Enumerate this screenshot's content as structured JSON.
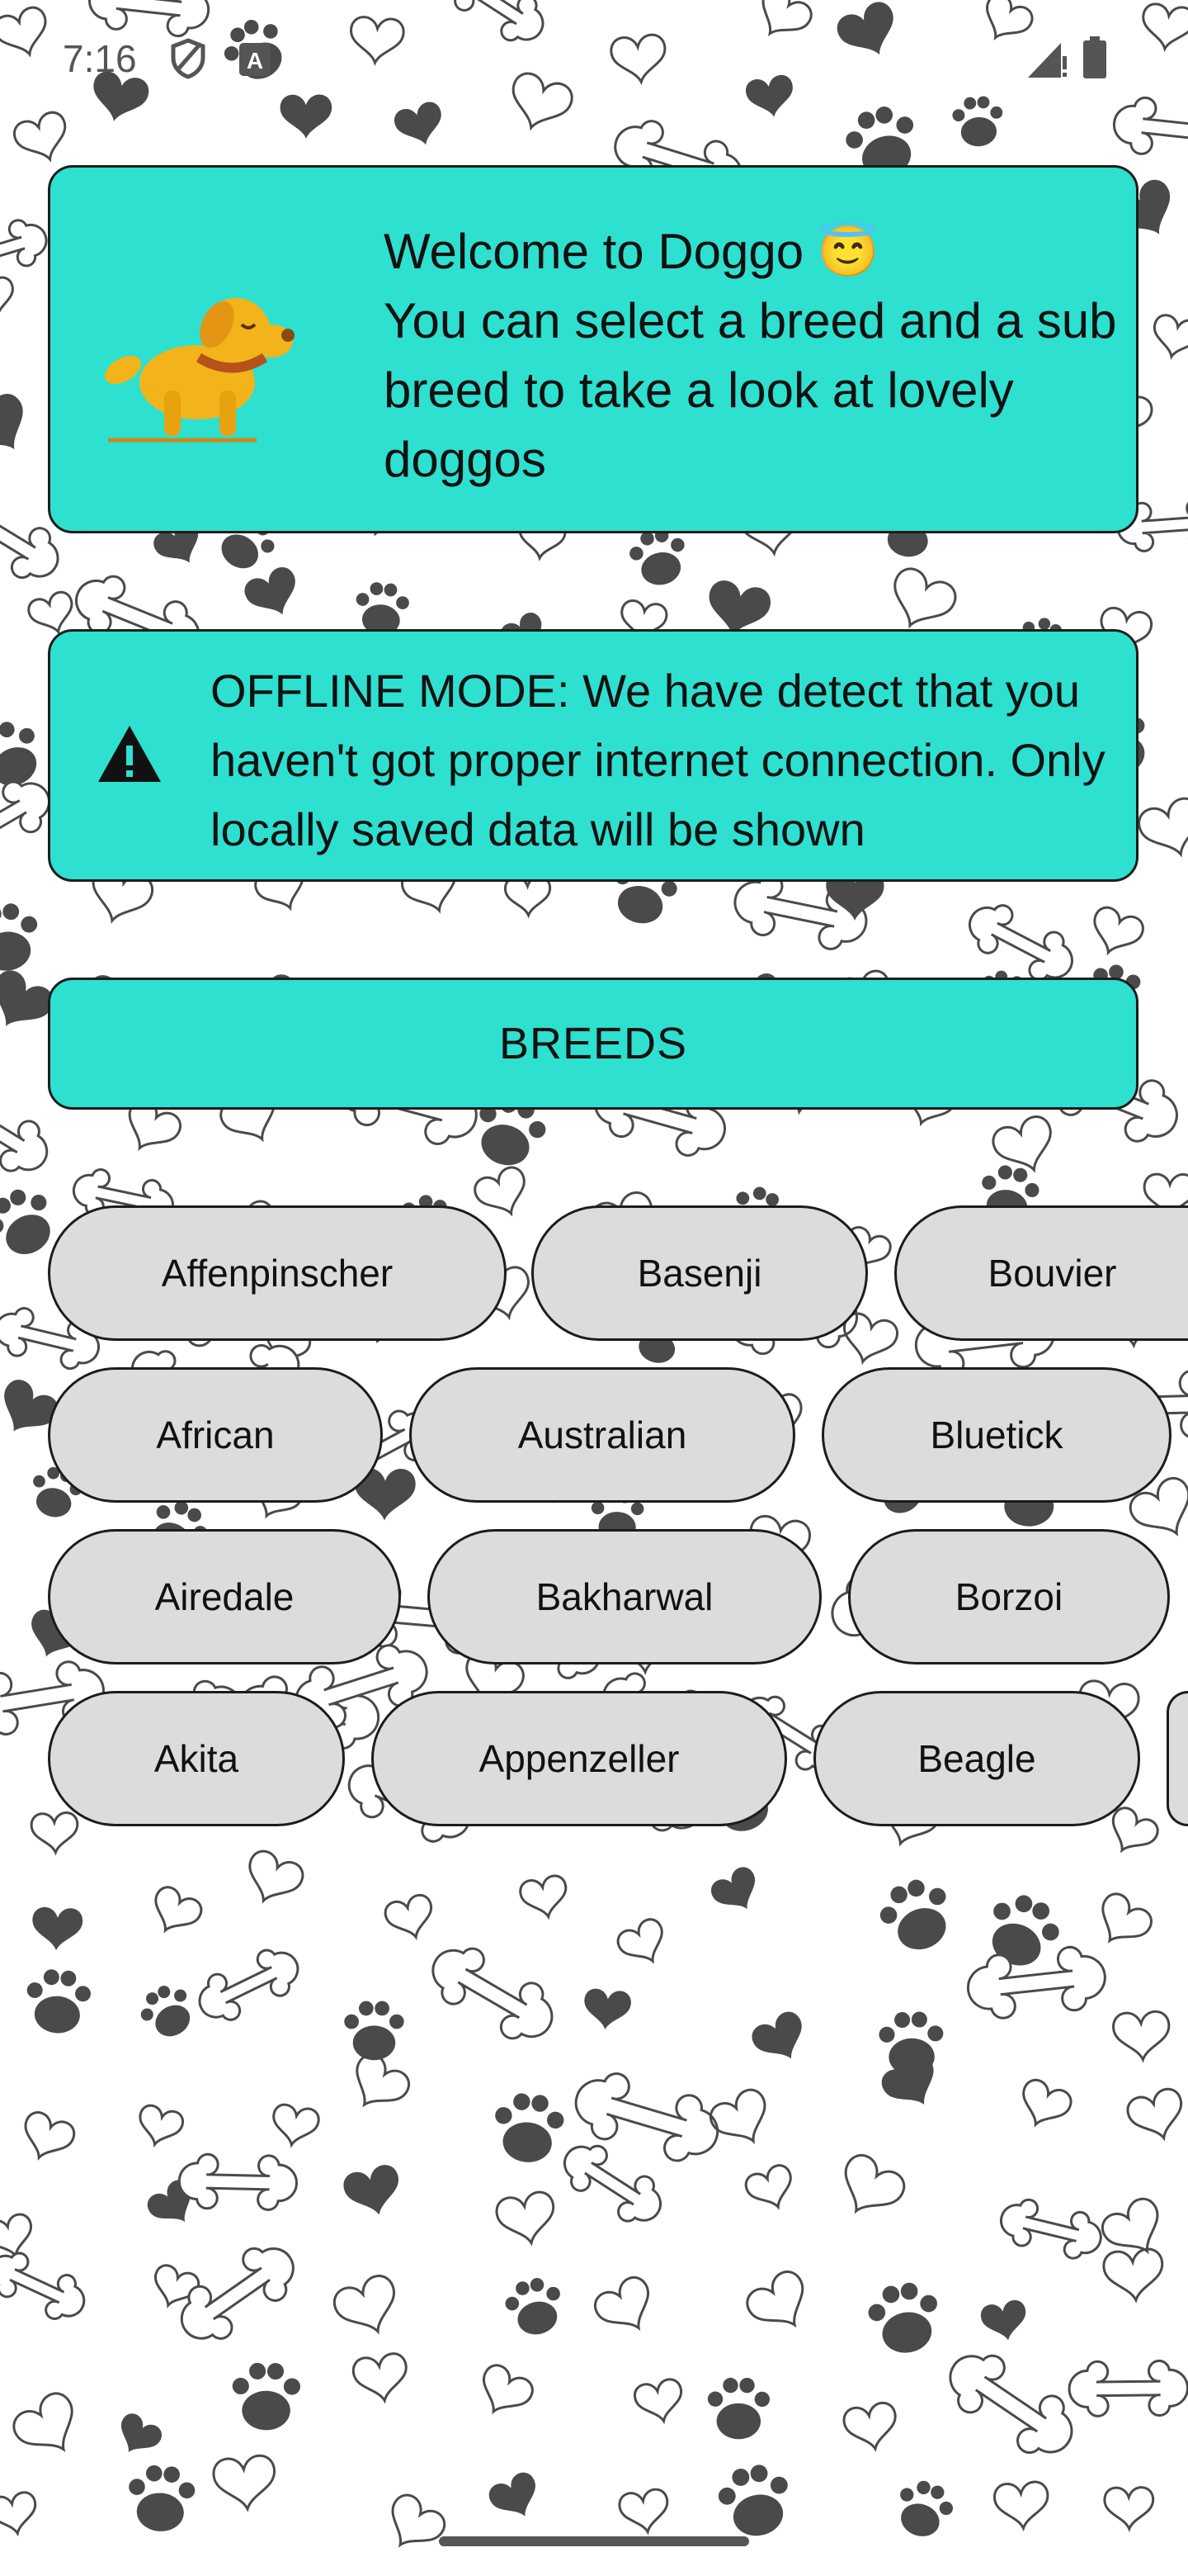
{
  "status_bar": {
    "time": "7:16",
    "icons": [
      "shield-icon",
      "font-a-icon",
      "signal-icon",
      "battery-icon"
    ]
  },
  "welcome": {
    "title": "Welcome to Doggo 😇",
    "body": "You can select a breed and a sub breed to take a look at lovely doggos",
    "icon": "dog-illustration-icon"
  },
  "offline": {
    "icon": "warning-icon",
    "message": "OFFLINE MODE: We have detect that you haven't got proper internet connection. Only locally saved data will be shown"
  },
  "breeds_button": {
    "label": "BREEDS"
  },
  "breeds": [
    [
      "Affenpinscher",
      "Basenji",
      "Bouvier"
    ],
    [
      "African",
      "Australian",
      "Bluetick"
    ],
    [
      "Airedale",
      "Bakharwal",
      "Borzoi"
    ],
    [
      "Akita",
      "Appenzeller",
      "Beagle",
      ""
    ]
  ],
  "colors": {
    "card": "#2ee0cf",
    "chip": "#dcdcdc",
    "border": "#1c1c1c",
    "pattern": "#4a4a4a"
  }
}
